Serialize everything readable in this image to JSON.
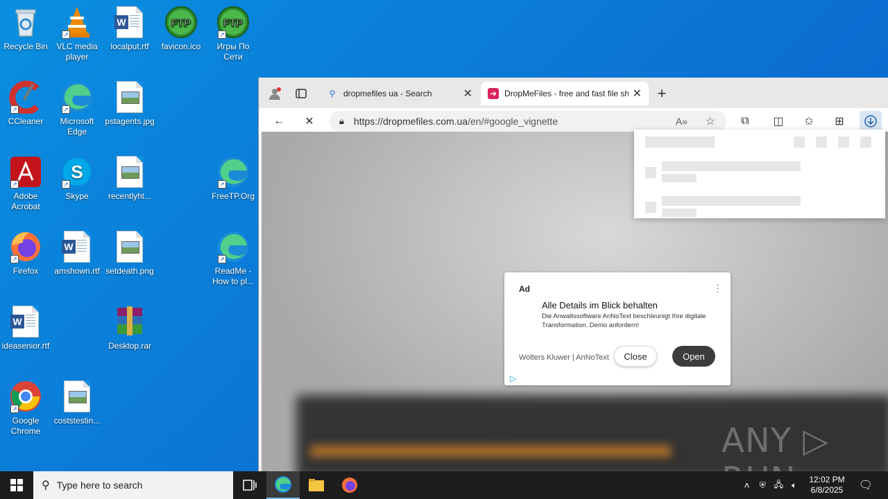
{
  "desktop": {
    "icons": [
      {
        "label": "Recycle Bin",
        "icon": "recycle-bin-icon"
      },
      {
        "label": "VLC media player",
        "icon": "vlc-icon"
      },
      {
        "label": "localput.rtf",
        "icon": "word-doc-icon"
      },
      {
        "label": "favicon.ico",
        "icon": "ftp-icon"
      },
      {
        "label": "Игры По Сети",
        "icon": "ftp-icon"
      },
      {
        "label": "CCleaner",
        "icon": "ccleaner-icon"
      },
      {
        "label": "Microsoft Edge",
        "icon": "edge-icon"
      },
      {
        "label": "pstagents.jpg",
        "icon": "image-file-icon"
      },
      {
        "label": "Adobe Acrobat",
        "icon": "acrobat-icon"
      },
      {
        "label": "Skype",
        "icon": "skype-icon"
      },
      {
        "label": "recentlyht...",
        "icon": "image-file-icon"
      },
      {
        "label": "FreeTP.Org",
        "icon": "edge-icon"
      },
      {
        "label": "Firefox",
        "icon": "firefox-icon"
      },
      {
        "label": "amshown.rtf",
        "icon": "word-doc-icon"
      },
      {
        "label": "setdeath.png",
        "icon": "image-file-icon"
      },
      {
        "label": "ReadMe - How to pl...",
        "icon": "edge-icon"
      },
      {
        "label": "ideasenior.rtf",
        "icon": "word-doc-icon"
      },
      {
        "label": "Desktop.rar",
        "icon": "winrar-icon"
      },
      {
        "label": "Google Chrome",
        "icon": "chrome-icon"
      },
      {
        "label": "coststestin...",
        "icon": "image-file-icon"
      }
    ]
  },
  "browser": {
    "tabs": [
      {
        "title": "dropmefiles ua - Search"
      },
      {
        "title": "DropMeFiles - free and fast file sharing"
      }
    ],
    "url_host": "https://dropmefiles.com.ua",
    "url_path": "/en/#google_vignette"
  },
  "ad": {
    "label": "Ad",
    "headline": "Alle Details im Blick behalten",
    "body": "Die Anwaltssoftware AnNoText beschleunigt Ihre digitale Transformation. Demo anfordern!",
    "advertiser": "Wolters Kluwer | AnNoText",
    "close_label": "Close",
    "open_label": "Open"
  },
  "watermark": "ANY ▷ RUN",
  "taskbar": {
    "search_placeholder": "Type here to search",
    "time": "12:02 PM",
    "date": "6/8/2025"
  }
}
